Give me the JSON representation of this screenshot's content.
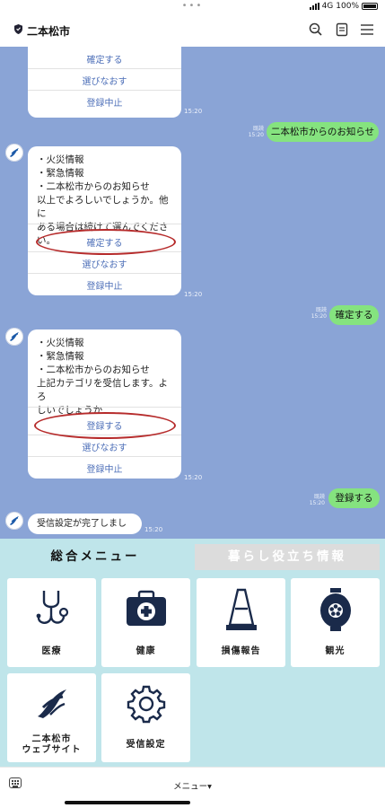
{
  "status_bar": {
    "dots": "•••",
    "network": "4G",
    "battery": "100%"
  },
  "header": {
    "title": "二本松市",
    "icons": [
      "shield-icon",
      "search-icon",
      "note-icon",
      "menu-icon"
    ]
  },
  "chat": {
    "msg1": {
      "confirm": "確定する",
      "reselect": "選びなおす",
      "cancel": "登録中止",
      "time": "15:20"
    },
    "user1": {
      "text": "二本松市からのお知らせ",
      "read": "既読",
      "time": "15:20"
    },
    "msg2": {
      "lines": [
        "・火災情報",
        "・緊急情報",
        "・二本松市からのお知らせ",
        "以上でよろしいでしょうか。他に",
        "ある場合は続けて選んでください。"
      ],
      "confirm": "確定する",
      "reselect": "選びなおす",
      "cancel": "登録中止",
      "time": "15:20"
    },
    "user2": {
      "text": "確定する",
      "read": "既読",
      "time": "15:20"
    },
    "msg3": {
      "lines": [
        "・火災情報",
        "・緊急情報",
        "・二本松市からのお知らせ",
        "上記カテゴリを受信します。よろ",
        "しいでしょうか"
      ],
      "register": "登録する",
      "reselect": "選びなおす",
      "cancel": "登録中止",
      "time": "15:20"
    },
    "user3": {
      "text": "登録する",
      "read": "既読",
      "time": "15:20"
    },
    "msg4": {
      "text": "受信設定が完了しました",
      "time": "15:20"
    }
  },
  "menu": {
    "tab_active": "総合メニュー",
    "tab_inactive": "暮らし役立ち情報",
    "tiles": {
      "medical": "医療",
      "health": "健康",
      "damage": "損傷報告",
      "tourism": "観光",
      "website_l1": "二本松市",
      "website_l2": "ウェブサイト",
      "settings": "受信設定"
    },
    "colors": {
      "tab_bg": "#bfe5ea",
      "tile_icon": "#1a2a4a"
    }
  },
  "footer": {
    "label": "メニュー▾"
  }
}
